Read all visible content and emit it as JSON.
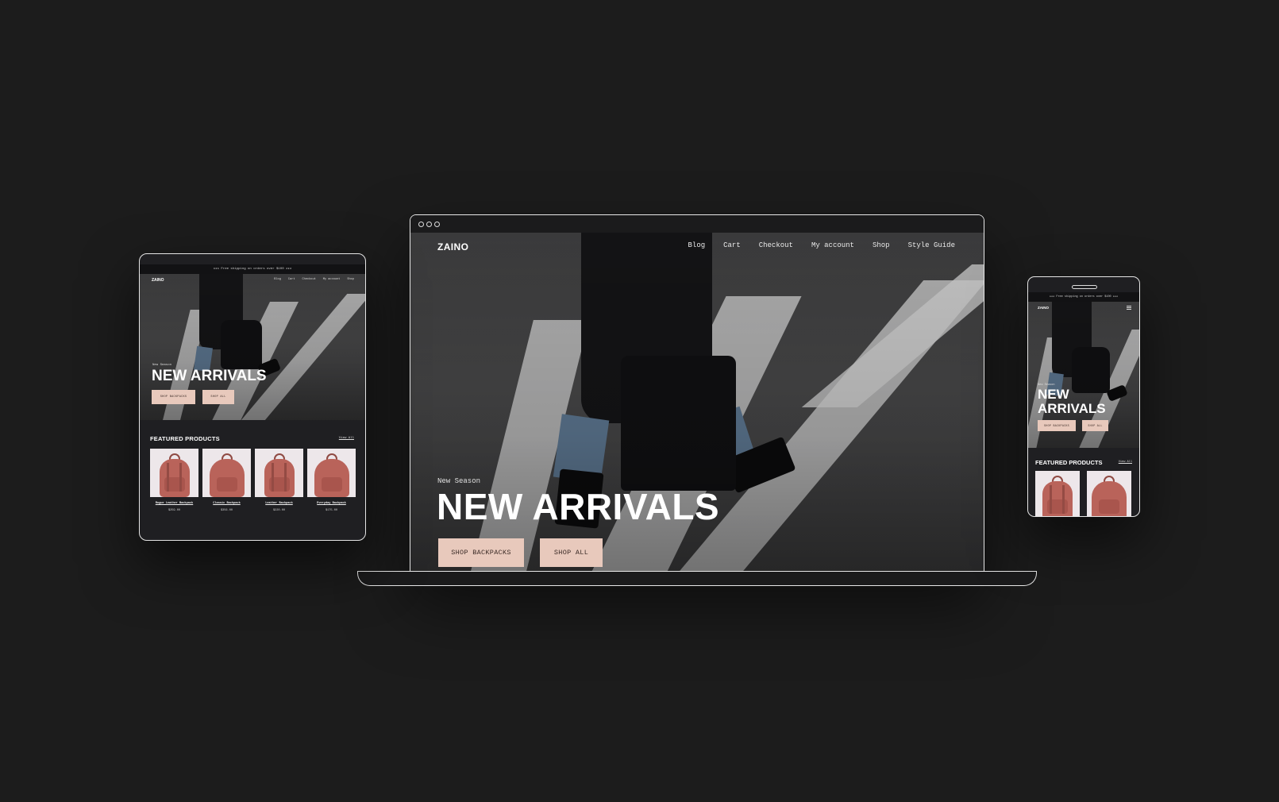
{
  "laptop": {
    "logo": "ZAINO",
    "nav": [
      "Blog",
      "Cart",
      "Checkout",
      "My account",
      "Shop",
      "Style Guide"
    ],
    "hero": {
      "kicker": "New Season",
      "headline": "NEW ARRIVALS",
      "primary_button": "SHOP BACKPACKS",
      "secondary_button": "SHOP ALL"
    }
  },
  "tablet": {
    "promo_bar": "★★★ Free shipping on orders over $100 ★★★",
    "logo": "ZAINO",
    "nav": [
      "Blog",
      "Cart",
      "Checkout",
      "My account",
      "Shop"
    ],
    "hero": {
      "kicker": "New Season",
      "headline": "NEW ARRIVALS",
      "primary_button": "SHOP BACKPACKS",
      "secondary_button": "SHOP ALL"
    },
    "featured_title": "FEATURED PRODUCTS",
    "view_all": "View All",
    "products": [
      {
        "name": "Rogue Leather Backpack",
        "price": "$259.00"
      },
      {
        "name": "Classic Backpack",
        "price": "$356.00"
      },
      {
        "name": "Leather Backpack",
        "price": "$220.00"
      },
      {
        "name": "Everyday Backpack",
        "price": "$175.00"
      }
    ]
  },
  "phone": {
    "promo_bar": "★★★ Free shipping on orders over $100 ★★★",
    "logo": "ZAINO",
    "hero": {
      "kicker": "New Season",
      "headline": "NEW ARRIVALS",
      "primary_button": "SHOP BACKPACKS",
      "secondary_button": "SHOP ALL"
    },
    "featured_title": "FEATURED PRODUCTS",
    "view_all": "View All"
  },
  "icons": {
    "window_controls": "three-outline-dots",
    "menu": "hamburger-icon"
  },
  "colors": {
    "background": "#1c1c1c",
    "button_pink": "#e8c9bc",
    "backpack": "#b9635a"
  }
}
